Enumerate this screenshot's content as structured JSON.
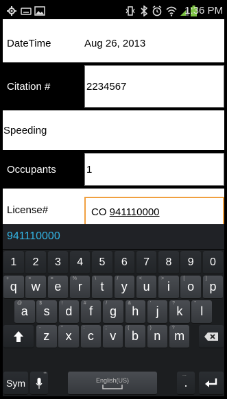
{
  "status_bar": {
    "time": "1:36 PM"
  },
  "form": {
    "rows": [
      {
        "label": "DateTime",
        "value": "Aug 26, 2013"
      },
      {
        "label": "Citation #",
        "value": "2234567"
      },
      {
        "label": "",
        "value": "Speeding"
      },
      {
        "label": "Occupants",
        "value": "1"
      },
      {
        "label": "License#",
        "value_prefix": "CO ",
        "value_underlined": "941110000"
      }
    ]
  },
  "keyboard": {
    "suggestion": "941110000",
    "number_row": [
      "1",
      "2",
      "3",
      "4",
      "5",
      "6",
      "7",
      "8",
      "9",
      "0"
    ],
    "row1": [
      {
        "k": "q",
        "h": "+"
      },
      {
        "k": "w",
        "h": "×"
      },
      {
        "k": "e",
        "h": "="
      },
      {
        "k": "r",
        "h": "%"
      },
      {
        "k": "t",
        "h": "\\"
      },
      {
        "k": "y",
        "h": "/"
      },
      {
        "k": "u",
        "h": "<"
      },
      {
        "k": "i",
        "h": ">"
      },
      {
        "k": "o",
        "h": "["
      },
      {
        "k": "p",
        "h": "]"
      }
    ],
    "row2": [
      {
        "k": "a",
        "h": "@"
      },
      {
        "k": "s",
        "h": "$"
      },
      {
        "k": "d",
        "h": "!"
      },
      {
        "k": "f",
        "h": "#"
      },
      {
        "k": "g",
        "h": "/"
      },
      {
        "k": "h",
        "h": "&"
      },
      {
        "k": "j",
        "h": "'"
      },
      {
        "k": "k",
        "h": "?"
      },
      {
        "k": "l",
        "h": "\""
      }
    ],
    "row3": [
      {
        "k": "z",
        "h": "-"
      },
      {
        "k": "x",
        "h": "\""
      },
      {
        "k": "c",
        "h": ":"
      },
      {
        "k": "v",
        "h": ";"
      },
      {
        "k": "b",
        "h": "("
      },
      {
        "k": "n",
        "h": ")"
      },
      {
        "k": "m",
        "h": "?"
      }
    ],
    "sym_label": "Sym",
    "space_label": "English(US)",
    "period_label": ".",
    "ellipsis_hint": "..."
  }
}
